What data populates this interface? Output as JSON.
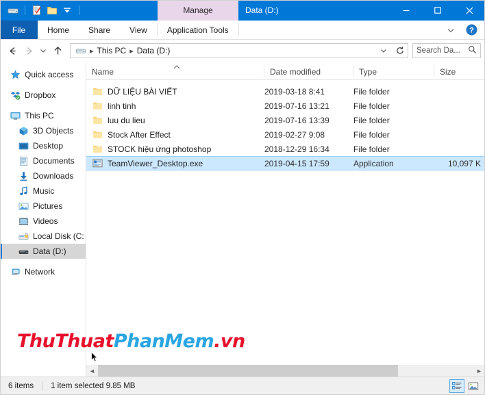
{
  "titlebar": {
    "quick_access": [
      {
        "name": "drive-icon",
        "label": "Data (D:)"
      },
      {
        "name": "properties-icon",
        "label": "Properties"
      },
      {
        "name": "new-folder-icon",
        "label": "New folder"
      },
      {
        "name": "customize-dropdown-icon",
        "label": "Customize Quick Access Toolbar"
      }
    ],
    "contextual_tab": "Manage",
    "window_title": "Data (D:)",
    "controls": [
      {
        "name": "minimize-button",
        "label": "Minimize"
      },
      {
        "name": "maximize-button",
        "label": "Maximize"
      },
      {
        "name": "close-button",
        "label": "Close"
      }
    ],
    "accent_color": "#0078d7",
    "contextual_tab_color": "#e9d6ea"
  },
  "ribbon": {
    "file_tab": "File",
    "tabs": [
      "Home",
      "Share",
      "View"
    ],
    "contextual_group": "Application Tools",
    "expand_label": "Expand the Ribbon",
    "help_label": "Help"
  },
  "addressbar": {
    "back_label": "Back",
    "forward_label": "Forward",
    "recent_label": "Recent locations",
    "up_label": "Up",
    "breadcrumbs": [
      "This PC",
      "Data (D:)"
    ],
    "dropdown_label": "Previous locations",
    "refresh_label": "Refresh",
    "search": {
      "placeholder": "Search Da...",
      "value": ""
    }
  },
  "sidebar": {
    "items": [
      {
        "label": "Quick access",
        "icon": "star-icon",
        "indent": false,
        "selected": false,
        "gap_after": true
      },
      {
        "label": "Dropbox",
        "icon": "dropbox-icon",
        "indent": false,
        "selected": false,
        "gap_after": true
      },
      {
        "label": "This PC",
        "icon": "monitor-icon",
        "indent": false,
        "selected": false,
        "gap_after": false
      },
      {
        "label": "3D Objects",
        "icon": "3d-objects-icon",
        "indent": true,
        "selected": false,
        "gap_after": false
      },
      {
        "label": "Desktop",
        "icon": "desktop-icon",
        "indent": true,
        "selected": false,
        "gap_after": false
      },
      {
        "label": "Documents",
        "icon": "documents-icon",
        "indent": true,
        "selected": false,
        "gap_after": false
      },
      {
        "label": "Downloads",
        "icon": "downloads-icon",
        "indent": true,
        "selected": false,
        "gap_after": false
      },
      {
        "label": "Music",
        "icon": "music-icon",
        "indent": true,
        "selected": false,
        "gap_after": false
      },
      {
        "label": "Pictures",
        "icon": "pictures-icon",
        "indent": true,
        "selected": false,
        "gap_after": false
      },
      {
        "label": "Videos",
        "icon": "videos-icon",
        "indent": true,
        "selected": false,
        "gap_after": false
      },
      {
        "label": "Local Disk (C:",
        "icon": "local-disk-icon",
        "indent": true,
        "selected": false,
        "gap_after": false
      },
      {
        "label": "Data (D:)",
        "icon": "drive-icon",
        "indent": true,
        "selected": true,
        "gap_after": true
      },
      {
        "label": "Network",
        "icon": "network-icon",
        "indent": false,
        "selected": false,
        "gap_after": false
      }
    ]
  },
  "filelist": {
    "columns": [
      {
        "key": "name",
        "label": "Name",
        "sorted": "asc"
      },
      {
        "key": "date",
        "label": "Date modified",
        "sorted": ""
      },
      {
        "key": "type",
        "label": "Type",
        "sorted": ""
      },
      {
        "key": "size",
        "label": "Size",
        "sorted": ""
      }
    ],
    "rows": [
      {
        "name": "DỮ LIỆU BÀI VIẾT",
        "date": "2019-03-18 8:41",
        "type": "File folder",
        "size": "",
        "icon": "folder-icon",
        "selected": false
      },
      {
        "name": "linh tinh",
        "date": "2019-07-16 13:21",
        "type": "File folder",
        "size": "",
        "icon": "folder-icon",
        "selected": false
      },
      {
        "name": "luu du lieu",
        "date": "2019-07-16 13:39",
        "type": "File folder",
        "size": "",
        "icon": "folder-icon",
        "selected": false
      },
      {
        "name": "Stock After Effect",
        "date": "2019-02-27 9:08",
        "type": "File folder",
        "size": "",
        "icon": "folder-icon",
        "selected": false
      },
      {
        "name": "STOCK hiệu ứng photoshop",
        "date": "2018-12-29 16:34",
        "type": "File folder",
        "size": "",
        "icon": "folder-icon",
        "selected": false
      },
      {
        "name": "TeamViewer_Desktop.exe",
        "date": "2019-04-15 17:59",
        "type": "Application",
        "size": "10,097 K",
        "icon": "application-icon",
        "selected": true
      }
    ],
    "selection_color": "#cce8ff"
  },
  "watermark": {
    "part1": "ThuThuat",
    "part2": "PhanMem",
    "part3": ".vn",
    "color1": "#e8112d",
    "color2": "#29a5e3"
  },
  "statusbar": {
    "item_count": "6 items",
    "selection_info": "1 item selected  9.85 MB",
    "views": [
      {
        "name": "details-view-button",
        "label": "Details",
        "active": true
      },
      {
        "name": "large-icons-view-button",
        "label": "Large icons",
        "active": false
      }
    ]
  }
}
